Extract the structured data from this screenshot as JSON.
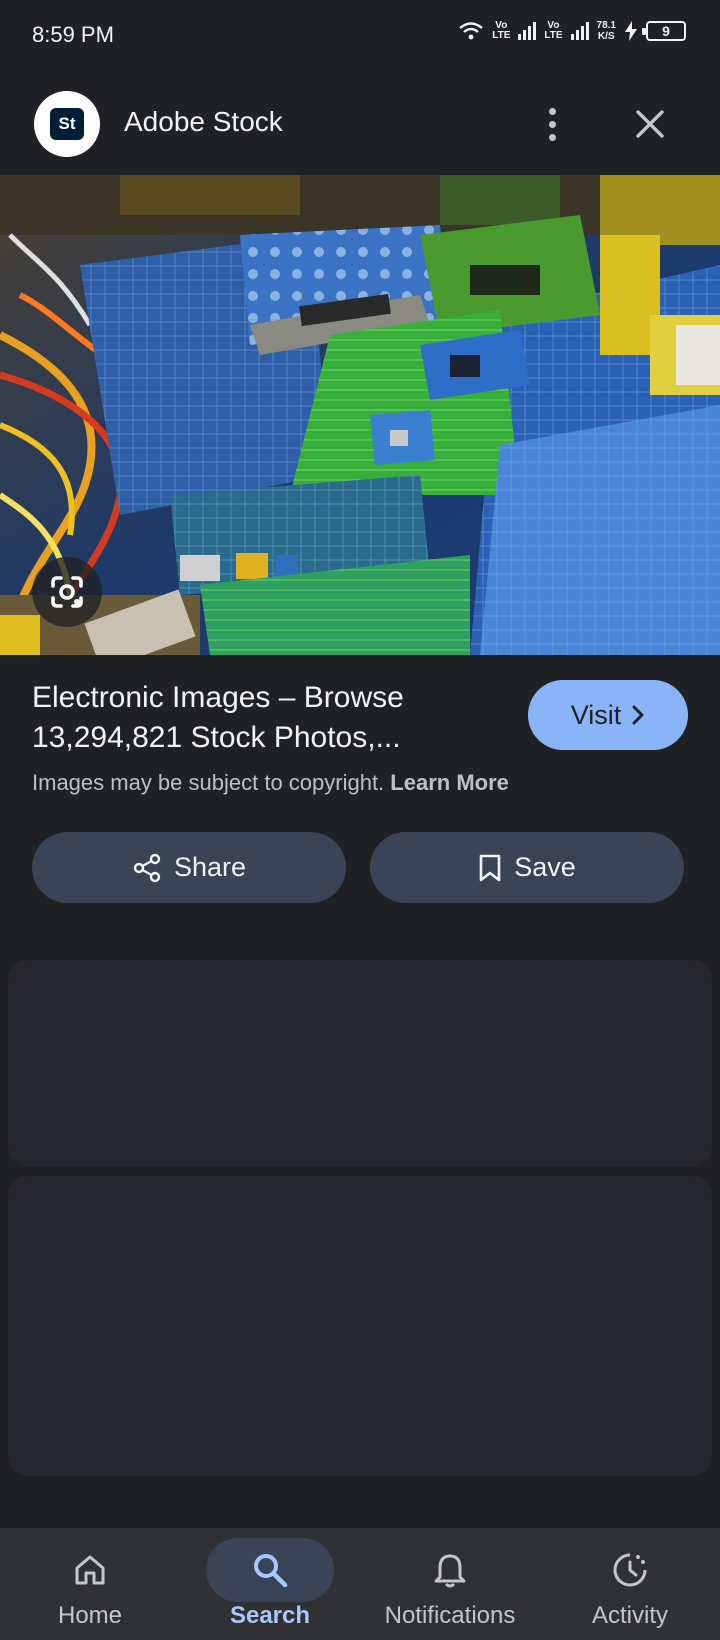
{
  "status_bar": {
    "time": "8:59 PM",
    "sim1": "Vo LTE",
    "sim1_top": "Vo",
    "sim1_bottom": "LTE",
    "sim2_top": "Vo",
    "sim2_bottom": "LTE",
    "speed_value": "78.1",
    "speed_unit": "K/S",
    "battery": "9"
  },
  "header": {
    "logo_text": "St",
    "site_name": "Adobe Stock",
    "more_icon": "more-vert-icon",
    "close_icon": "close-icon"
  },
  "result": {
    "title": "Electronic Images – Browse 13,294,821 Stock Photos,...",
    "visit_label": "Visit",
    "copyright_text": "Images may be subject to copyright.",
    "learn_more": "Learn More"
  },
  "actions": {
    "share_label": "Share",
    "save_label": "Save"
  },
  "bottom_nav": {
    "items": [
      {
        "label": "Home",
        "icon": "home-icon"
      },
      {
        "label": "Search",
        "icon": "search-icon",
        "active": true
      },
      {
        "label": "Notifications",
        "icon": "bell-icon"
      },
      {
        "label": "Activity",
        "icon": "activity-icon"
      }
    ]
  },
  "colors": {
    "background": "#202124",
    "accent": "#8ab4f8",
    "button": "#394457",
    "nav_active": "#a8c7fa"
  }
}
